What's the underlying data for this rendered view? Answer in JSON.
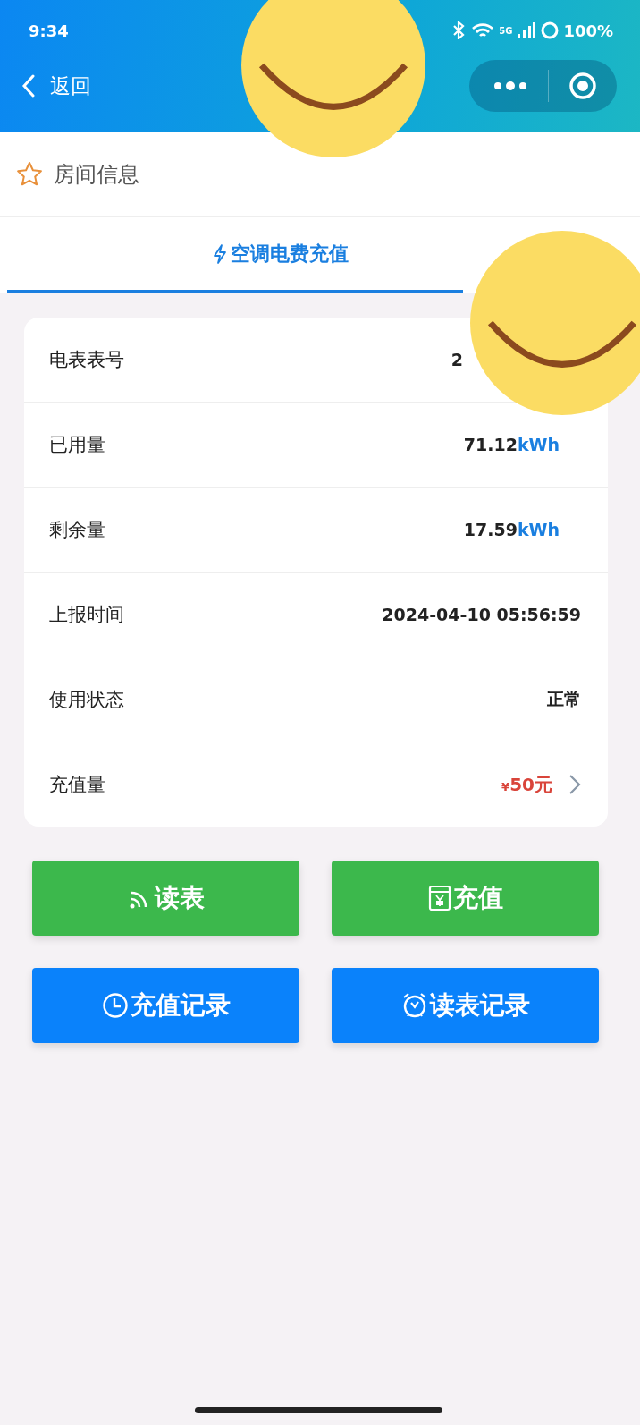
{
  "status_bar": {
    "time": "9:34",
    "network": "5G",
    "battery": "100%"
  },
  "nav": {
    "back_label": "返回"
  },
  "section": {
    "title": "房间信息"
  },
  "tabs": [
    {
      "label": "空调电费充值",
      "selected": true
    }
  ],
  "rows": [
    {
      "kind": "covered",
      "label": "电表表号",
      "value": "2"
    },
    {
      "kind": "unit",
      "label": "已用量",
      "value": "71.12",
      "unit": "kWh"
    },
    {
      "kind": "unit",
      "label": "剩余量",
      "value": "17.59",
      "unit": "kWh"
    },
    {
      "kind": "plain",
      "label": "上报时间",
      "value": "2024-04-10 05:56:59"
    },
    {
      "kind": "plain",
      "label": "使用状态",
      "value": "正常"
    },
    {
      "kind": "money",
      "label": "充值量",
      "currency": "¥",
      "value": "50元"
    }
  ],
  "buttons": [
    {
      "kind": "read",
      "label": "读表",
      "color": "#3cb84c"
    },
    {
      "kind": "pay",
      "label": "充值",
      "color": "#3cb84c"
    },
    {
      "kind": "clock",
      "label": "充值记录",
      "color": "#0a82fb"
    },
    {
      "kind": "alarm",
      "label": "读表记录",
      "color": "#0a82fb"
    }
  ]
}
